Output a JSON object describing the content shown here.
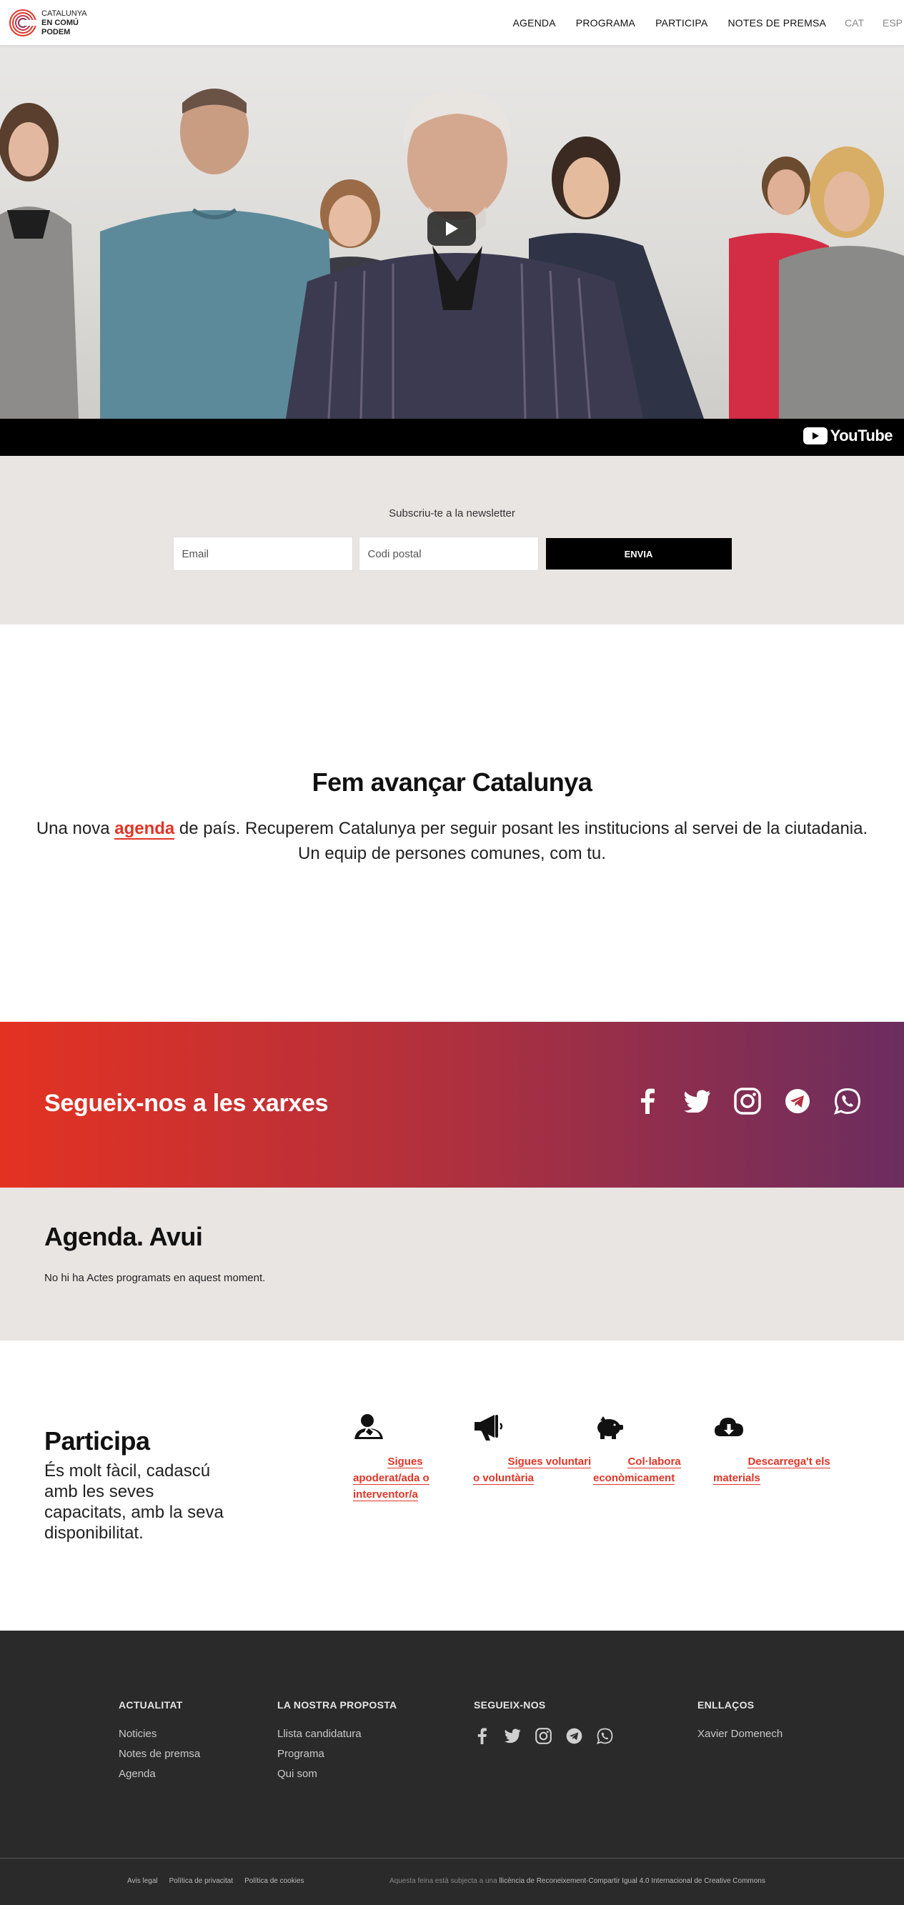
{
  "header": {
    "logo": {
      "line1": "CATALUNYA",
      "line2": "EN COMÚ",
      "line3": "PODEM"
    },
    "nav": [
      "AGENDA",
      "PROGRAMA",
      "PARTICIPA",
      "NOTES DE PREMSA"
    ],
    "languages": [
      "CAT",
      "ESP"
    ]
  },
  "video": {
    "provider_label": "YouTube"
  },
  "newsletter": {
    "title": "Subscriu-te a la newsletter",
    "email_placeholder": "Email",
    "postal_placeholder": "Codi postal",
    "submit_label": "ENVIA"
  },
  "intro": {
    "title": "Fem avançar Catalunya",
    "text_before": "Una nova ",
    "link_text": "agenda",
    "text_after": " de país. Recuperem Catalunya per seguir posant les institucions al servei de la ciutadania.",
    "line2": "Un equip de persones comunes, com tu."
  },
  "social": {
    "title": "Segueix-nos a les xarxes",
    "icons": [
      "facebook-icon",
      "twitter-icon",
      "instagram-icon",
      "telegram-icon",
      "whatsapp-icon"
    ]
  },
  "agenda": {
    "title": "Agenda. Avui",
    "empty_message": "No hi ha Actes programats en aquest moment."
  },
  "participa": {
    "title": "Participa",
    "text": "És molt fàcil, cadascú amb les seves capacitats, amb la seva disponibilitat.",
    "cards": [
      {
        "icon": "user-icon",
        "label": "Sigues apoderat/ada o interventor/a"
      },
      {
        "icon": "megaphone-icon",
        "label": "Sigues voluntari o voluntària"
      },
      {
        "icon": "piggy-bank-icon",
        "label": "Col·labora econòmicament"
      },
      {
        "icon": "cloud-download-icon",
        "label": "Descarrega't els materials"
      }
    ]
  },
  "footer": {
    "columns": [
      {
        "heading": "ACTUALITAT",
        "links": [
          "Noticies",
          "Notes de premsa",
          "Agenda"
        ]
      },
      {
        "heading": "LA NOSTRA PROPOSTA",
        "links": [
          "Llista candidatura",
          "Programa",
          "Qui som"
        ]
      },
      {
        "heading": "SEGUEIX-NOS",
        "links": []
      },
      {
        "heading": "ENLLAÇOS",
        "links": [
          "Xavier Domenech"
        ]
      }
    ],
    "bottom_links": [
      "Avis legal",
      "Política de privacitat",
      "Política de cookies"
    ],
    "license_prefix": "Aquesta feina està subjecta a una ",
    "license_link": "llicència de Reconeixement-Compartir Igual 4.0 Internacional de Creative Commons"
  },
  "colors": {
    "accent": "#e03526",
    "gradient_start": "#e43222",
    "gradient_end": "#6b2d5f",
    "footer_bg": "#2a2a2a",
    "section_bg": "#e9e5e3"
  }
}
